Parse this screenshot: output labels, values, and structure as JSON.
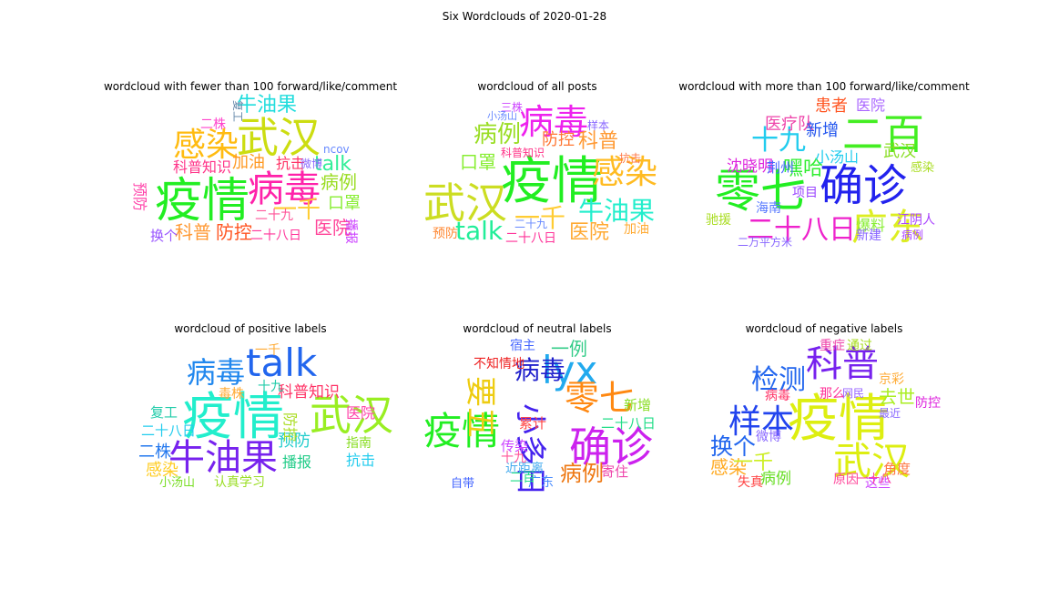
{
  "figure": {
    "title": "Six Wordclouds of 2020-01-28"
  },
  "panels": [
    {
      "title": "wordcloud with fewer than 100 forward/like/comment",
      "words": [
        {
          "text": "疫情",
          "color": "#22ee22"
        },
        {
          "text": "病毒",
          "color": "#ff22aa"
        },
        {
          "text": "武汉",
          "color": "#ccdd11"
        },
        {
          "text": "感染",
          "color": "#ffbb11"
        },
        {
          "text": "牛油果",
          "color": "#22dddd"
        },
        {
          "text": "talk",
          "color": "#33ee99"
        },
        {
          "text": "科普知识",
          "color": "#ff3388"
        },
        {
          "text": "加油",
          "color": "#ff9922"
        },
        {
          "text": "抗击",
          "color": "#ff3366"
        },
        {
          "text": "病例",
          "color": "#99dd22"
        },
        {
          "text": "医院",
          "color": "#ff4499"
        },
        {
          "text": "防控",
          "color": "#ff5522"
        },
        {
          "text": "科普",
          "color": "#ff9933"
        },
        {
          "text": "换个",
          "color": "#9955ff"
        },
        {
          "text": "二十八日",
          "color": "#ff3399"
        },
        {
          "text": "口罩",
          "color": "#88ee33"
        },
        {
          "text": "预防",
          "color": "#ff44aa"
        },
        {
          "text": "一千",
          "color": "#ffcc33"
        },
        {
          "text": "二株",
          "color": "#ff44cc"
        },
        {
          "text": "ncov",
          "color": "#6688ff"
        },
        {
          "text": "微博",
          "color": "#8866ff"
        },
        {
          "text": "二十九",
          "color": "#ff5599"
        },
        {
          "text": "播报",
          "color": "#cc44ff"
        },
        {
          "text": "复工",
          "color": "#6688aa"
        }
      ]
    },
    {
      "title": "wordcloud of all posts",
      "words": [
        {
          "text": "疫情",
          "color": "#22ee22"
        },
        {
          "text": "武汉",
          "color": "#ccdd22"
        },
        {
          "text": "病毒",
          "color": "#ee22ee"
        },
        {
          "text": "感染",
          "color": "#ffbb22"
        },
        {
          "text": "牛油果",
          "color": "#22eecc"
        },
        {
          "text": "talk",
          "color": "#22ee99"
        },
        {
          "text": "病例",
          "color": "#99dd22"
        },
        {
          "text": "科普",
          "color": "#ff9933"
        },
        {
          "text": "防控",
          "color": "#ff7733"
        },
        {
          "text": "口罩",
          "color": "#88ee33"
        },
        {
          "text": "医院",
          "color": "#ffaa33"
        },
        {
          "text": "一千",
          "color": "#ffcc33"
        },
        {
          "text": "科普知识",
          "color": "#ff3388"
        },
        {
          "text": "三株",
          "color": "#cc44ff"
        },
        {
          "text": "样本",
          "color": "#8866ff"
        },
        {
          "text": "抗击",
          "color": "#ff7744"
        },
        {
          "text": "预防",
          "color": "#ff8833"
        },
        {
          "text": "加油",
          "color": "#ffaa33"
        },
        {
          "text": "二十八日",
          "color": "#ff3399"
        },
        {
          "text": "二十九",
          "color": "#6688ff"
        },
        {
          "text": "小汤山",
          "color": "#6688ff"
        }
      ]
    },
    {
      "title": "wordcloud with more than 100 forward/like/comment",
      "words": [
        {
          "text": "确诊",
          "color": "#2222ee"
        },
        {
          "text": "零七",
          "color": "#22ee22"
        },
        {
          "text": "二百",
          "color": "#44ee22"
        },
        {
          "text": "十九",
          "color": "#22ccee"
        },
        {
          "text": "广东",
          "color": "#ddee22"
        },
        {
          "text": "二十八日",
          "color": "#ee22cc"
        },
        {
          "text": "医疗队",
          "color": "#ee44aa"
        },
        {
          "text": "新增",
          "color": "#2255ee"
        },
        {
          "text": "嘿哈",
          "color": "#33ee33"
        },
        {
          "text": "武汉",
          "color": "#88dd22"
        },
        {
          "text": "沈晓明",
          "color": "#dd22dd"
        },
        {
          "text": "患者",
          "color": "#ff5522"
        },
        {
          "text": "医院",
          "color": "#aa66ff"
        },
        {
          "text": "江阴人",
          "color": "#aa44ff"
        },
        {
          "text": "爆料",
          "color": "#88ee33"
        },
        {
          "text": "荆州",
          "color": "#4466ff"
        },
        {
          "text": "小汤山",
          "color": "#22ccee"
        },
        {
          "text": "感染",
          "color": "#aadd22"
        },
        {
          "text": "海南",
          "color": "#5577ff"
        },
        {
          "text": "驰援",
          "color": "#aadd22"
        },
        {
          "text": "新建",
          "color": "#8866ff"
        },
        {
          "text": "病例",
          "color": "#aa44ff"
        },
        {
          "text": "二万平方米",
          "color": "#8866ff"
        },
        {
          "text": "项目",
          "color": "#9944ff"
        }
      ]
    },
    {
      "title": "wordcloud of positive labels",
      "words": [
        {
          "text": "疫情",
          "color": "#22eecc"
        },
        {
          "text": "talk",
          "color": "#2266ee"
        },
        {
          "text": "病毒",
          "color": "#2288ee"
        },
        {
          "text": "牛油果",
          "color": "#7722ee"
        },
        {
          "text": "武汉",
          "color": "#99ee22"
        },
        {
          "text": "科普知识",
          "color": "#ff3366"
        },
        {
          "text": "预防",
          "color": "#22cccc"
        },
        {
          "text": "感染",
          "color": "#ffcc22"
        },
        {
          "text": "抗击",
          "color": "#22ccee"
        },
        {
          "text": "二株",
          "color": "#2277ee"
        },
        {
          "text": "复工",
          "color": "#22ccaa"
        },
        {
          "text": "认真学习",
          "color": "#99dd22"
        },
        {
          "text": "小汤山",
          "color": "#77dd22"
        },
        {
          "text": "医院",
          "color": "#ff44aa"
        },
        {
          "text": "指南",
          "color": "#88dd22"
        },
        {
          "text": "播报",
          "color": "#22cc88"
        },
        {
          "text": "防控",
          "color": "#aadd22"
        },
        {
          "text": "二十八日",
          "color": "#22ccee"
        },
        {
          "text": "一千",
          "color": "#ffaa33"
        },
        {
          "text": "毒株",
          "color": "#ffaa33"
        },
        {
          "text": "十九",
          "color": "#22ccaa"
        }
      ]
    },
    {
      "title": "wordcloud of neutral labels",
      "words": [
        {
          "text": "lyx",
          "color": "#22aaee"
        },
        {
          "text": "确诊",
          "color": "#cc22ee"
        },
        {
          "text": "零七",
          "color": "#ff8811"
        },
        {
          "text": "小多日",
          "color": "#4422ee"
        },
        {
          "text": "疫情",
          "color": "#22ee22"
        },
        {
          "text": "病毒",
          "color": "#2222cc"
        },
        {
          "text": "病例",
          "color": "#ee7711"
        },
        {
          "text": "不知情地",
          "color": "#ee2222"
        },
        {
          "text": "新增",
          "color": "#88dd22"
        },
        {
          "text": "一例",
          "color": "#33cc88"
        },
        {
          "text": "要五",
          "color": "#eecc11"
        },
        {
          "text": "传染",
          "color": "#cc44ff"
        },
        {
          "text": "累计",
          "color": "#ff4444"
        },
        {
          "text": "二十八日",
          "color": "#22dd88"
        },
        {
          "text": "近距离",
          "color": "#44aaee"
        },
        {
          "text": "寄住",
          "color": "#ee44aa"
        },
        {
          "text": "自带",
          "color": "#4466ff"
        },
        {
          "text": "广东",
          "color": "#4488ff"
        },
        {
          "text": "十九",
          "color": "#ff5599"
        },
        {
          "text": "二百",
          "color": "#22dd88"
        },
        {
          "text": "宿主",
          "color": "#4466ff"
        }
      ]
    },
    {
      "title": "wordcloud of negative labels",
      "words": [
        {
          "text": "疫情",
          "color": "#ddee11"
        },
        {
          "text": "武汉",
          "color": "#ddee11"
        },
        {
          "text": "科普",
          "color": "#7722ee"
        },
        {
          "text": "样本",
          "color": "#2244ee"
        },
        {
          "text": "检测",
          "color": "#2266ee"
        },
        {
          "text": "换个",
          "color": "#2266ee"
        },
        {
          "text": "感染",
          "color": "#ffaa22"
        },
        {
          "text": "去世",
          "color": "#aaee22"
        },
        {
          "text": "病例",
          "color": "#66dd22"
        },
        {
          "text": "重症",
          "color": "#ee44aa"
        },
        {
          "text": "通过",
          "color": "#aadd22"
        },
        {
          "text": "一千",
          "color": "#ccee22"
        },
        {
          "text": "京彩",
          "color": "#ffaa33"
        },
        {
          "text": "防控",
          "color": "#dd22dd"
        },
        {
          "text": "病毒",
          "color": "#ff3366"
        },
        {
          "text": "那么",
          "color": "#ff3399"
        },
        {
          "text": "微博",
          "color": "#8866ff"
        },
        {
          "text": "失真",
          "color": "#ff4444"
        },
        {
          "text": "原因",
          "color": "#ff4499"
        },
        {
          "text": "角度",
          "color": "#ff7744"
        },
        {
          "text": "这些",
          "color": "#cc44ff"
        },
        {
          "text": "网民",
          "color": "#9966ff"
        },
        {
          "text": "最近",
          "color": "#8866ff"
        },
        {
          "text": "一十八",
          "color": "#ff4499"
        }
      ]
    }
  ]
}
